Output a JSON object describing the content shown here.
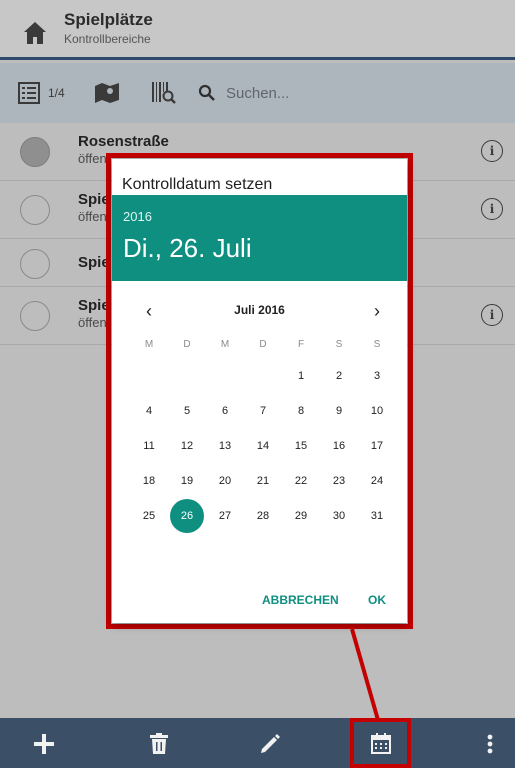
{
  "header": {
    "title": "Spielplätze",
    "subtitle": "Kontrollbereiche"
  },
  "toolbar": {
    "page_counter": "1/4",
    "search_placeholder": "Suchen...",
    "icons": [
      "list-icon",
      "map-icon",
      "barcode-search-icon",
      "search-icon"
    ]
  },
  "list": {
    "items": [
      {
        "title": "Rosenstraße",
        "subtitle": "öffen",
        "status": "filled",
        "has_info": true
      },
      {
        "title": "Spie",
        "subtitle": "öffen",
        "status": "empty",
        "has_info": true
      },
      {
        "title": "Spie",
        "subtitle": "",
        "status": "empty",
        "has_info": false
      },
      {
        "title": "Spie",
        "subtitle": "öffen",
        "status": "empty",
        "has_info": true
      }
    ]
  },
  "dialog": {
    "title": "Kontrolldatum setzen",
    "year": "2016",
    "selected_date": "Di., 26. Juli",
    "month_label": "Juli 2016",
    "weekdays": [
      "M",
      "D",
      "M",
      "D",
      "F",
      "S",
      "S"
    ],
    "weeks": [
      [
        "",
        "",
        "",
        "",
        "1",
        "2",
        "3"
      ],
      [
        "4",
        "5",
        "6",
        "7",
        "8",
        "9",
        "10"
      ],
      [
        "11",
        "12",
        "13",
        "14",
        "15",
        "16",
        "17"
      ],
      [
        "18",
        "19",
        "20",
        "21",
        "22",
        "23",
        "24"
      ],
      [
        "25",
        "26",
        "27",
        "28",
        "29",
        "30",
        "31"
      ]
    ],
    "selected_day": "26",
    "cancel_label": "ABBRECHEN",
    "ok_label": "OK"
  },
  "bottom_bar": {
    "buttons": [
      "add-icon",
      "delete-icon",
      "edit-icon",
      "calendar-icon",
      "more-icon"
    ]
  },
  "colors": {
    "accent": "#0f8f80",
    "highlight": "#c40000",
    "bottom_bar": "#3b4f66"
  }
}
